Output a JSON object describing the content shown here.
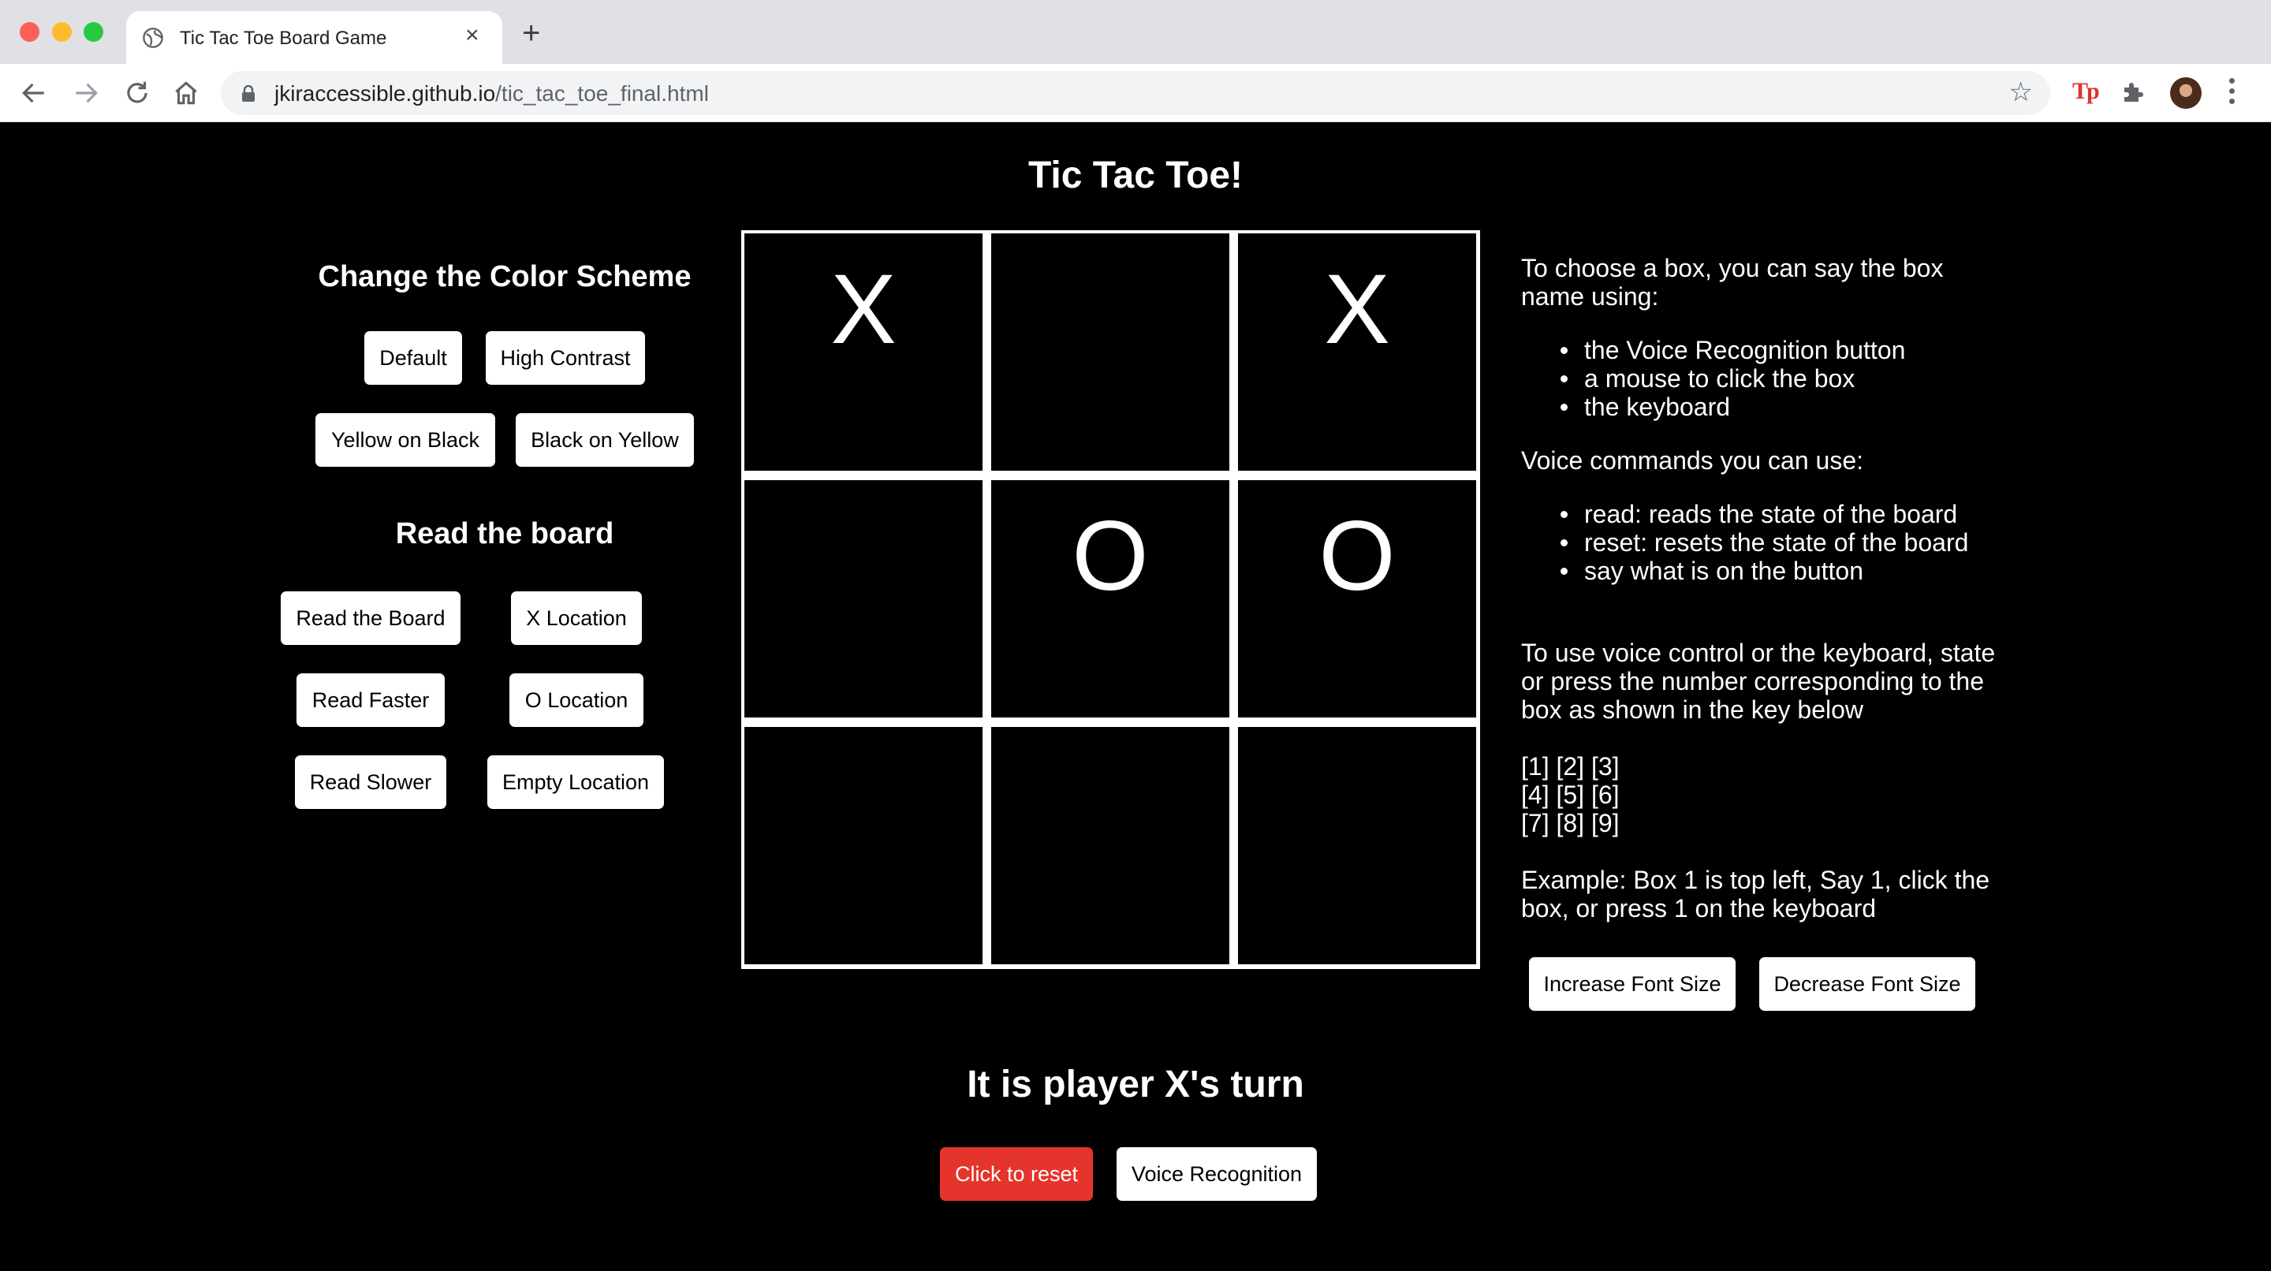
{
  "browser": {
    "tab_title": "Tic Tac Toe Board Game",
    "tab_close": "×",
    "new_tab": "+",
    "url_host": "jkiraccessible.github.io",
    "url_path": "/tic_tac_toe_final.html",
    "extension_label": "Tp"
  },
  "page": {
    "title": "Tic Tac Toe!",
    "status": "It is player X's turn"
  },
  "color_scheme": {
    "heading": "Change the Color Scheme",
    "buttons": [
      "Default",
      "High Contrast",
      "Yellow on Black",
      "Black on Yellow"
    ]
  },
  "read_board": {
    "heading": "Read the board",
    "buttons": [
      "Read the Board",
      "X Location",
      "Read Faster",
      "O Location",
      "Read Slower",
      "Empty Location"
    ]
  },
  "board": {
    "cells": [
      "X",
      "",
      "X",
      "",
      "O",
      "O",
      "",
      "",
      ""
    ]
  },
  "instructions": {
    "intro": "To choose a box, you can say the box name using:",
    "methods": [
      "the Voice Recognition button",
      "a mouse to click the box",
      "the keyboard"
    ],
    "commands_heading": "Voice commands you can use:",
    "commands": [
      "read: reads the state of the board",
      "reset: resets the state of the board",
      "say what is on the button"
    ],
    "keyboard_intro": "To use voice control or the keyboard, state or press the number corresponding to the box as shown in the key below",
    "key_rows": [
      "[1] [2] [3]",
      "[4] [5] [6]",
      "[7] [8] [9]"
    ],
    "example": "Example: Box 1 is top left, Say 1, click the box, or press 1 on the keyboard"
  },
  "font_controls": {
    "increase": "Increase Font Size",
    "decrease": "Decrease Font Size"
  },
  "actions": {
    "reset": "Click to reset",
    "voice": "Voice Recognition"
  },
  "colors": {
    "background": "#000000",
    "foreground": "#ffffff",
    "reset_button": "#e5342c"
  }
}
